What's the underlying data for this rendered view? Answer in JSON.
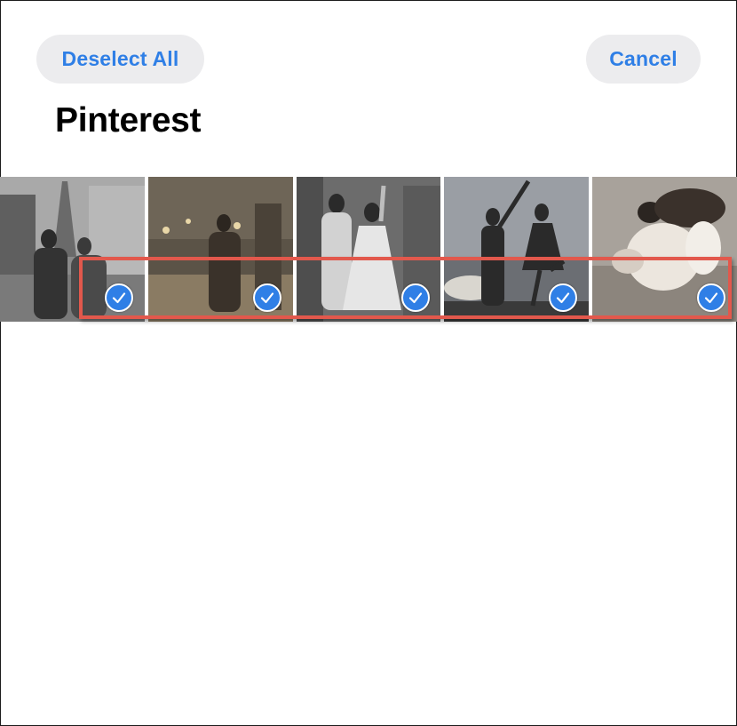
{
  "header": {
    "deselect_label": "Deselect All",
    "cancel_label": "Cancel"
  },
  "album": {
    "title": "Pinterest"
  },
  "photos": [
    {
      "icon": "photo-eiffel-couple",
      "selected": true
    },
    {
      "icon": "photo-night-street-couple",
      "selected": true
    },
    {
      "icon": "photo-dancing-couple",
      "selected": true
    },
    {
      "icon": "photo-silhouette-dance",
      "selected": true
    },
    {
      "icon": "photo-embracing-couple",
      "selected": true
    }
  ],
  "colors": {
    "accent": "#2f7fe6",
    "pill_background": "#ececee",
    "highlight_border": "#e2584c"
  }
}
